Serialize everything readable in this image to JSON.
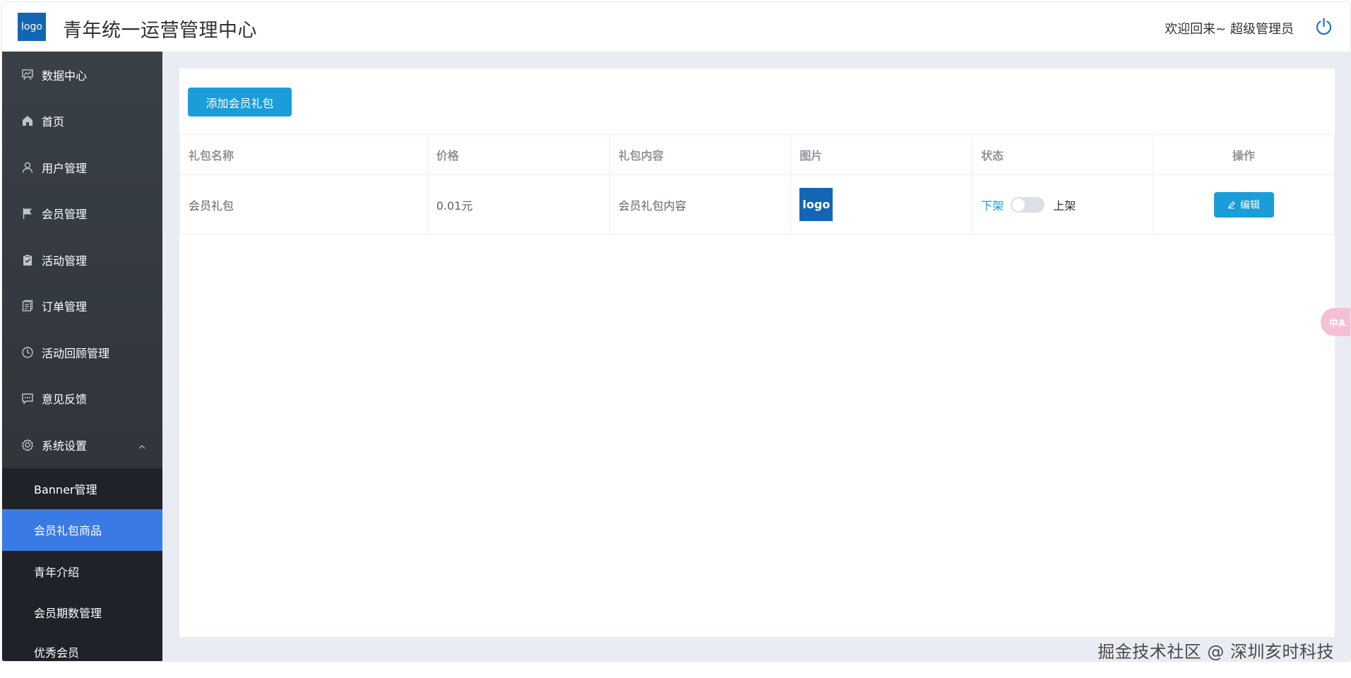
{
  "header": {
    "logo_text": "logo",
    "app_title": "青年统一运营管理中心",
    "welcome": "欢迎回来~ 超级管理员",
    "power_icon": "power-icon"
  },
  "sidebar": {
    "items": [
      {
        "label": "数据中心",
        "icon": "presentation-chart-icon"
      },
      {
        "label": "首页",
        "icon": "home-icon"
      },
      {
        "label": "用户管理",
        "icon": "user-icon"
      },
      {
        "label": "会员管理",
        "icon": "flag-icon"
      },
      {
        "label": "活动管理",
        "icon": "clipboard-check-icon"
      },
      {
        "label": "订单管理",
        "icon": "document-icon"
      },
      {
        "label": "活动回顾管理",
        "icon": "clock-icon"
      },
      {
        "label": "意见反馈",
        "icon": "chat-dots-icon"
      },
      {
        "label": "系统设置",
        "icon": "gear-icon",
        "expanded": true
      }
    ],
    "submenu": [
      {
        "label": "Banner管理"
      },
      {
        "label": "会员礼包商品",
        "active": true
      },
      {
        "label": "青年介绍"
      },
      {
        "label": "会员期数管理"
      },
      {
        "label": "优秀会员"
      }
    ]
  },
  "main": {
    "add_button": "添加会员礼包",
    "table": {
      "headers": [
        "礼包名称",
        "价格",
        "礼包内容",
        "图片",
        "状态",
        "操作"
      ],
      "rows": [
        {
          "name": "会员礼包",
          "price": "0.01元",
          "content": "会员礼包内容",
          "image_text": "logo",
          "status_off": "下架",
          "status_on": "上架",
          "status_value": false,
          "edit_label": "编辑"
        }
      ]
    }
  },
  "translate_fab": "中A",
  "watermark": "掘金技术社区 @ 深圳亥时科技",
  "colors": {
    "sidebar_bg": "#2f343b",
    "submenu_bg": "#1f2329",
    "active": "#3a7ae4",
    "primary": "#1a9dd9",
    "logo_bg": "#1366b4",
    "main_bg": "#e9edf3"
  }
}
